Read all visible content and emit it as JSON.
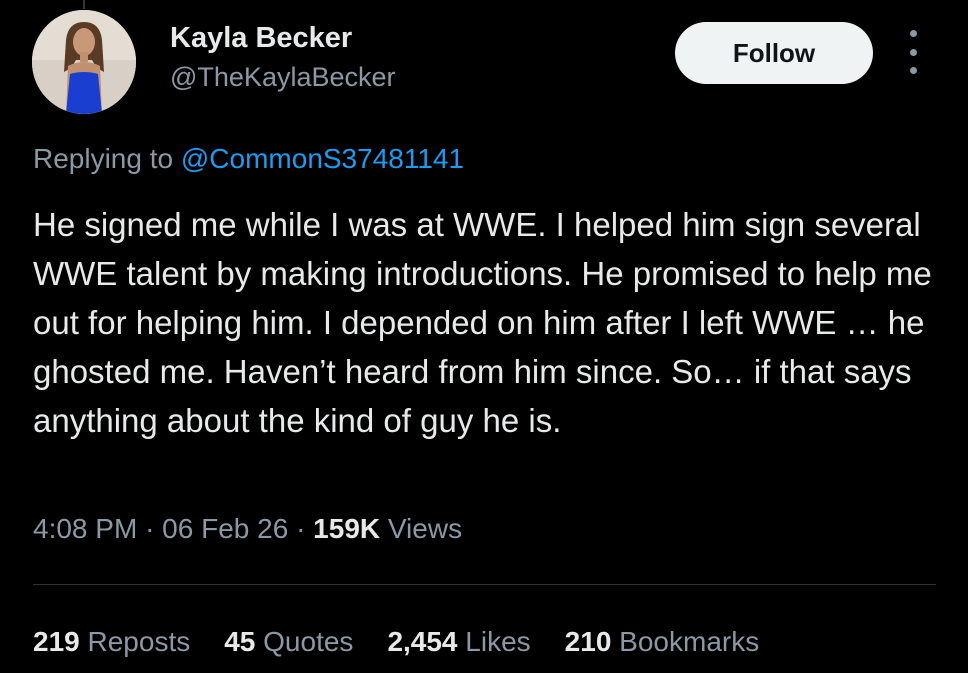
{
  "author": {
    "display_name": "Kayla Becker",
    "handle": "@TheKaylaBecker",
    "avatar_icon": "profile-photo"
  },
  "header": {
    "follow_label": "Follow",
    "more_icon": "more-vertical-icon"
  },
  "reply": {
    "prefix": "Replying to ",
    "mention": "@CommonS37481141"
  },
  "tweet": {
    "text": "He signed me while I was at WWE. I helped him sign several WWE talent by making introductions. He promised to help me out for helping him. I depended on him after I left WWE … he ghosted me. Haven’t heard from him since. So… if that says anything about the kind of guy he is."
  },
  "meta": {
    "time": "4:08 PM",
    "separator": "·",
    "date": "06 Feb 26",
    "views_count": "159K",
    "views_label": "Views"
  },
  "stats": {
    "reposts_count": "219",
    "reposts_label": "Reposts",
    "quotes_count": "45",
    "quotes_label": "Quotes",
    "likes_count": "2,454",
    "likes_label": "Likes",
    "bookmarks_count": "210",
    "bookmarks_label": "Bookmarks"
  },
  "colors": {
    "background": "#000000",
    "text_primary": "#e7e9ea",
    "text_secondary": "#8b98a5",
    "link": "#1d9bf0",
    "follow_bg": "#eff3f4",
    "divider": "#2f3336",
    "dress": "#1a3fd0"
  }
}
